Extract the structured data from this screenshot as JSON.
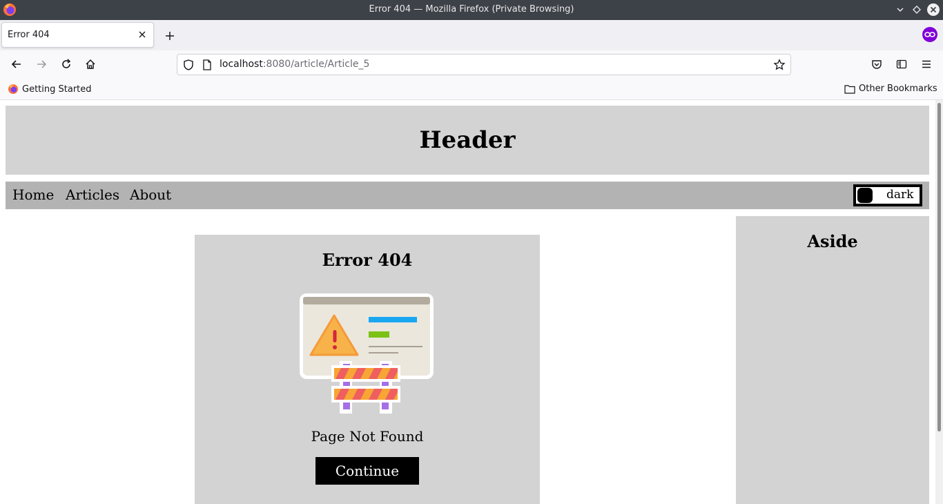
{
  "window": {
    "title": "Error 404 — Mozilla Firefox (Private Browsing)"
  },
  "tabs": [
    {
      "label": "Error 404"
    }
  ],
  "urlbar": {
    "host": "localhost",
    "rest": ":8080/article/Article_5"
  },
  "bookmarks": {
    "left_item": "Getting Started",
    "right_item": "Other Bookmarks"
  },
  "site": {
    "header_title": "Header",
    "nav": [
      "Home",
      "Articles",
      "About"
    ],
    "theme_toggle_label": "dark",
    "error_title": "Error 404",
    "error_message": "Page Not Found",
    "continue_label": "Continue",
    "aside_title": "Aside"
  },
  "colors": {
    "header_bg": "#d3d3d3",
    "nav_bg": "#b3b3b3",
    "button_bg": "#000000",
    "private_badge": "#8000d7"
  }
}
